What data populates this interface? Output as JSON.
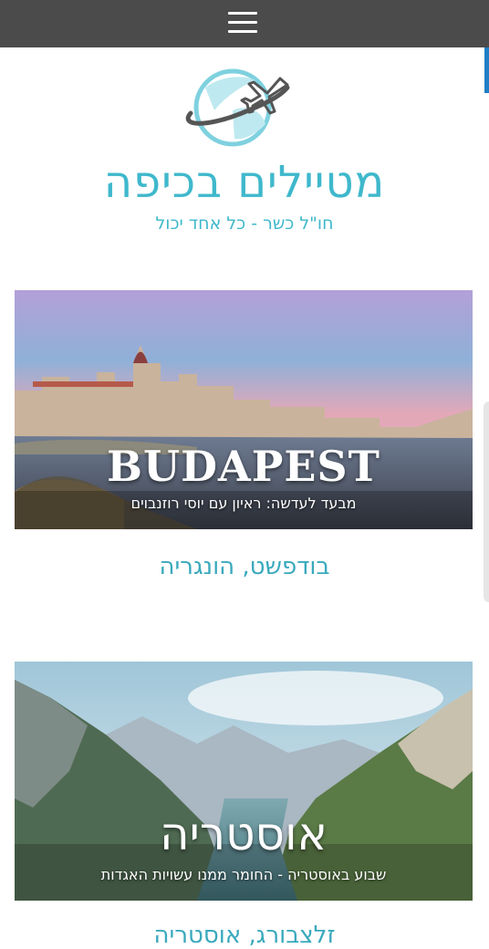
{
  "header": {
    "menu_icon": "hamburger-menu-icon"
  },
  "brand": {
    "logo_icon": "globe-airplane-icon",
    "title": "מטיילים בכיפה",
    "tagline": "חו\"ל כשר - כל אחד יכול",
    "accent_color": "#3fb8cc"
  },
  "posts": [
    {
      "image_title": "BUDAPEST",
      "image_subtitle": "מבעד לעדשה: ראיון עם יוסי רוזנבוים",
      "title": "בודפשט, הונגריה"
    },
    {
      "image_title": "אוסטריה",
      "image_subtitle": "שבוע באוסטריה - החומר ממנו עשויות האגדות",
      "title": "זלצבורג, אוסטריה"
    }
  ]
}
